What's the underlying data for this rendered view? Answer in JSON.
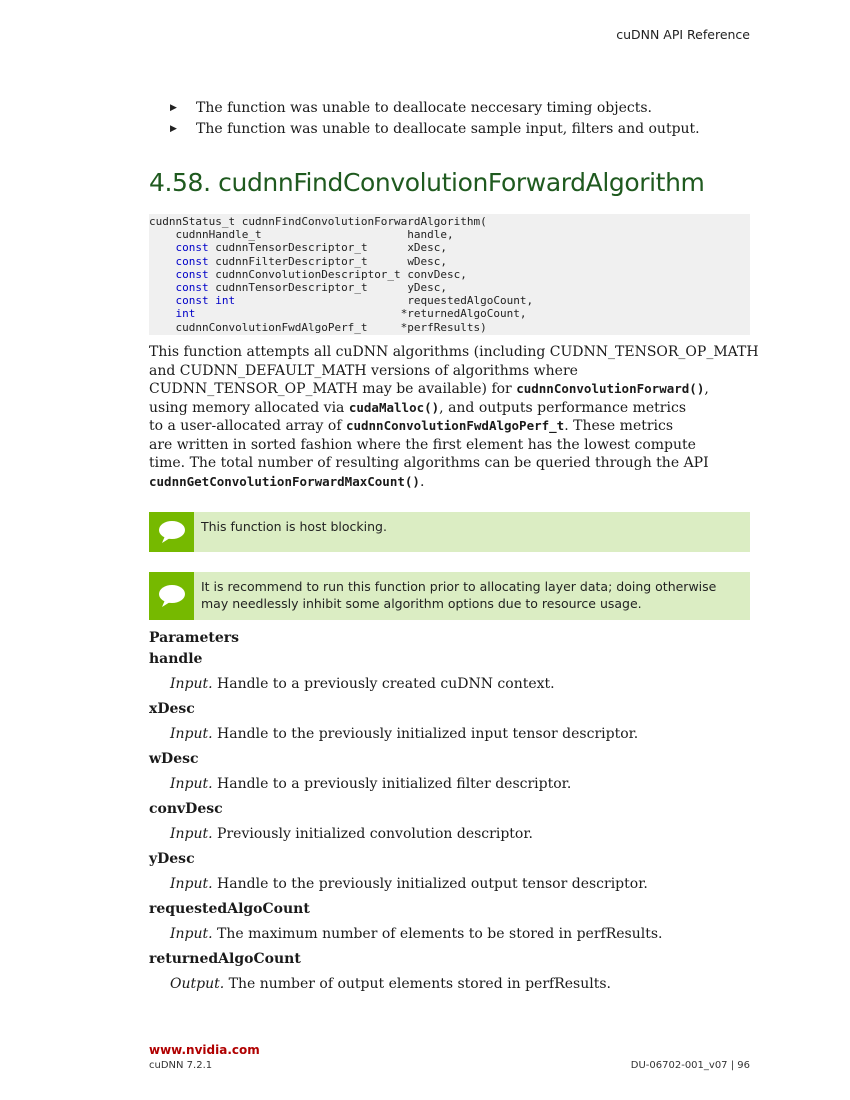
{
  "header": {
    "title": "cuDNN API Reference"
  },
  "bullets": [
    "The function was unable to deallocate neccesary timing objects.",
    "The function was unable to deallocate sample input, filters and output."
  ],
  "section": {
    "number": "4.58.",
    "title": "cudnnFindConvolutionForwardAlgorithm"
  },
  "code": {
    "line1": "cudnnStatus_t cudnnFindConvolutionForwardAlgorithm(",
    "lines": [
      {
        "kw": "",
        "type": "cudnnHandle_t                      ",
        "name": "handle,"
      },
      {
        "kw": "const",
        "type": " cudnnTensorDescriptor_t      ",
        "name": "xDesc,"
      },
      {
        "kw": "const",
        "type": " cudnnFilterDescriptor_t      ",
        "name": "wDesc,"
      },
      {
        "kw": "const",
        "type": " cudnnConvolutionDescriptor_t ",
        "name": "convDesc,"
      },
      {
        "kw": "const",
        "type": " cudnnTensorDescriptor_t      ",
        "name": "yDesc,"
      },
      {
        "kw": "const",
        "type": " ",
        "kw2": "int",
        "type2": "                          ",
        "name": "requestedAlgoCount,"
      },
      {
        "kw": "int",
        "type": "                               ",
        "name": "*returnedAlgoCount,"
      },
      {
        "kw": "",
        "type": "cudnnConvolutionFwdAlgoPerf_t     ",
        "name": "*perfResults)"
      }
    ]
  },
  "description": {
    "l1": "This function attempts all cuDNN algorithms (including CUDNN_TENSOR_OP_MATH",
    "l2": "and CUDNN_DEFAULT_MATH versions of algorithms where",
    "l3a": "CUDNN_TENSOR_OP_MATH may be available) for ",
    "l3b": "cudnnConvolutionForward()",
    "l3c": ",",
    "l4a": "using memory allocated via ",
    "l4b": "cudaMalloc()",
    "l4c": ", and outputs performance metrics",
    "l5a": "to a user-allocated array of ",
    "l5b": "cudnnConvolutionFwdAlgoPerf_t",
    "l5c": ". These metrics",
    "l6": "are written in sorted fashion where the first element has the lowest compute",
    "l7": "time. The total number of resulting algorithms can be queried through the API",
    "l8a": "cudnnGetConvolutionForwardMaxCount()",
    "l8b": "."
  },
  "notes": [
    "This function is host blocking.",
    "It is recommend to run this function prior to allocating layer data; doing otherwise may needlessly inhibit some algorithm options due to resource usage."
  ],
  "parameters": {
    "heading": "Parameters",
    "items": [
      {
        "name": "handle",
        "kind": "Input.",
        "text": " Handle to a previously created cuDNN context."
      },
      {
        "name": "xDesc",
        "kind": "Input.",
        "text": " Handle to the previously initialized input tensor descriptor."
      },
      {
        "name": "wDesc",
        "kind": "Input.",
        "text": " Handle to a previously initialized filter descriptor."
      },
      {
        "name": "convDesc",
        "kind": "Input.",
        "text": " Previously initialized convolution descriptor."
      },
      {
        "name": "yDesc",
        "kind": "Input.",
        "text": " Handle to the previously initialized output tensor descriptor."
      },
      {
        "name": "requestedAlgoCount",
        "kind": "Input.",
        "text": " The maximum number of elements to be stored in perfResults."
      },
      {
        "name": "returnedAlgoCount",
        "kind": "Output.",
        "text": " The number of output elements stored in perfResults."
      }
    ]
  },
  "footer": {
    "link": "www.nvidia.com",
    "product": "cuDNN 7.2.1",
    "docid": "DU-06702-001_v07 | 96"
  },
  "colors": {
    "accent_green": "#76b900",
    "note_bg": "#dbedc3",
    "title_green": "#1f5a1f",
    "link_red": "#b00000",
    "keyword_blue": "#0000c8"
  }
}
